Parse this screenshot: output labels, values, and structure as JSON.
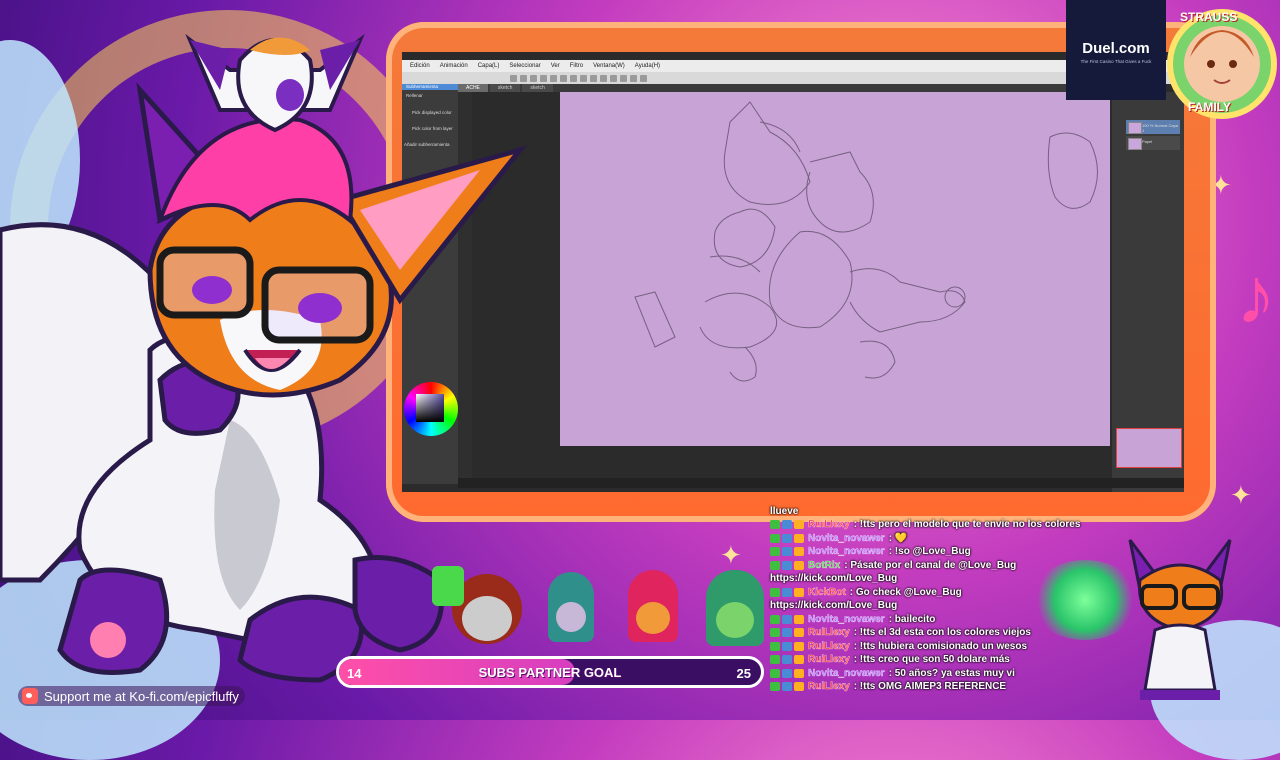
{
  "app": {
    "menu": [
      "Edición",
      "Animación",
      "Capa(L)",
      "Seleccionar",
      "Ver",
      "Filtro",
      "Ventana(W)",
      "Ayuda(H)"
    ],
    "tabs": [
      "ACHE",
      "sketch",
      "sketch"
    ],
    "left_panel": {
      "header": "Subherramienta",
      "items": [
        "Rellenar",
        "Pick displayed color",
        "Pick color from layer",
        "Añadir subherramienta"
      ]
    },
    "layers": [
      "100 % Normal Capa 1",
      "Papel"
    ]
  },
  "ad": {
    "brand": "Duel.com",
    "tagline": "The First Casino That Gives a Fuck"
  },
  "badge": {
    "line1": "STRAUSS",
    "line2": "FAMILY"
  },
  "chat": {
    "messages": [
      {
        "user": "",
        "text": "llueve",
        "color": "#ffffff"
      },
      {
        "user": "RuiLlexy",
        "text": ": !tts pero el modelo que te envie no los colores",
        "color": "#ff3b3b"
      },
      {
        "user": "Novita_novawer",
        "text": ": 💛",
        "color": "#b57bff"
      },
      {
        "user": "Novita_novawer",
        "text": ": !so @Love_Bug",
        "color": "#b57bff"
      },
      {
        "user": "BotRix",
        "text": ": Pásate por el canal de @Love_Bug",
        "color": "#4ad94a"
      },
      {
        "user": "",
        "text": "https://kick.com/Love_Bug",
        "color": "#ffffff"
      },
      {
        "user": "KickBot",
        "text": ": Go check @Love_Bug",
        "color": "#ff3b3b"
      },
      {
        "user": "",
        "text": "https://kick.com/Love_Bug",
        "color": "#ffffff"
      },
      {
        "user": "Novita_novawer",
        "text": ": bailecito",
        "color": "#b57bff"
      },
      {
        "user": "RuiLlexy",
        "text": ": !tts el 3d esta con los colores viejos",
        "color": "#ff3b3b"
      },
      {
        "user": "RuiLlexy",
        "text": ": !tts hubiera comisionado un wesos",
        "color": "#ff3b3b"
      },
      {
        "user": "RuiLlexy",
        "text": ": !tts creo que son 50 dolare más",
        "color": "#ff3b3b"
      },
      {
        "user": "Novita_novawer",
        "text": ": 50 años? ya estas muy vi",
        "color": "#b57bff"
      },
      {
        "user": "RuiLlexy",
        "text": ": !tts OMG AIMEP3 REFERENCE",
        "color": "#ff3b3b"
      }
    ]
  },
  "goal": {
    "label": "SUBS PARTNER GOAL",
    "current": "14",
    "target": "25",
    "progress": 0.56
  },
  "kofi": {
    "text": "Support me at Ko-fi.com/epicfluffy"
  },
  "colors": {
    "frame": "#f47a3a",
    "canvas": "#c8a3d6",
    "goal_fill": "#ff4fa8",
    "goal_bg": "#3a0f63"
  }
}
